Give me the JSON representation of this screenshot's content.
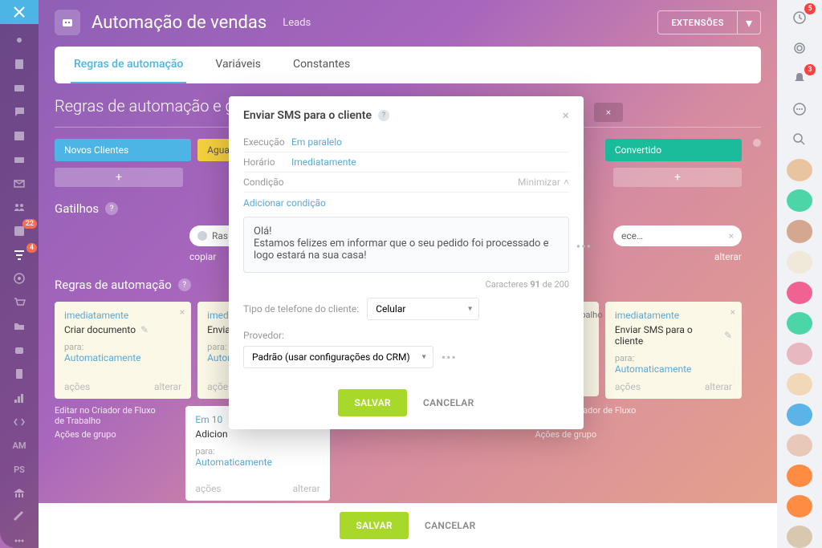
{
  "header": {
    "title": "Automação de vendas",
    "subtitle": "Leads",
    "extensions_label": "EXTENSÕES"
  },
  "tabs": {
    "t1": "Regras de automação",
    "t2": "Variáveis",
    "t3": "Constantes"
  },
  "page_heading": "Regras de automação e ga",
  "stages": {
    "s1": "Novos Clientes",
    "s2": "Aguar",
    "s5": "Convertido"
  },
  "triggers": {
    "heading": "Gatilhos",
    "copy": "copiar",
    "alter": "alterar",
    "pill1": "Ras",
    "pill4_prefix": "ece…"
  },
  "rules": {
    "heading": "Regras de automação",
    "immediate": "imediatamente",
    "in10": "Em 10",
    "create_doc": "Criar documento",
    "send_sms": "Enviar SMS para o cliente",
    "send_prefix": "Enviar",
    "add_prefix": "Adicion",
    "para": "para:",
    "auto": "Automaticamente",
    "autom_prefix": "Autom",
    "acoes": "ações",
    "alterar": "alterar",
    "wf_edit": "Editar no Criador de Fluxo de Trabalho",
    "wf_group": "Ações de grupo"
  },
  "modal": {
    "title": "Enviar SMS para o cliente",
    "exec_label": "Execução",
    "exec_val": "Em paralelo",
    "time_label": "Horário",
    "time_val": "Imediatamente",
    "cond_label": "Condição",
    "minimize": "Minimizar",
    "add_cond": "Adicionar condição",
    "message": "Olá!\nEstamos felizes em informar que o seu pedido foi processado e logo estará na sua casa!",
    "counter_prefix": "Caracteres",
    "counter_cur": "91",
    "counter_of": "de",
    "counter_max": "200",
    "phone_type_label": "Tipo de telefone do cliente:",
    "phone_type_val": "Celular",
    "provider_label": "Provedor:",
    "provider_val": "Padrão (usar configurações do CRM)",
    "save": "SALVAR",
    "cancel": "CANCELAR"
  },
  "bottom": {
    "save": "SALVAR",
    "cancel": "CANCELAR"
  },
  "leftrail": {
    "badge1": "22",
    "badge2": "4",
    "am": "AM",
    "ps": "PS"
  },
  "rightrail": {
    "badge_top": "5",
    "badge_bell": "3"
  }
}
